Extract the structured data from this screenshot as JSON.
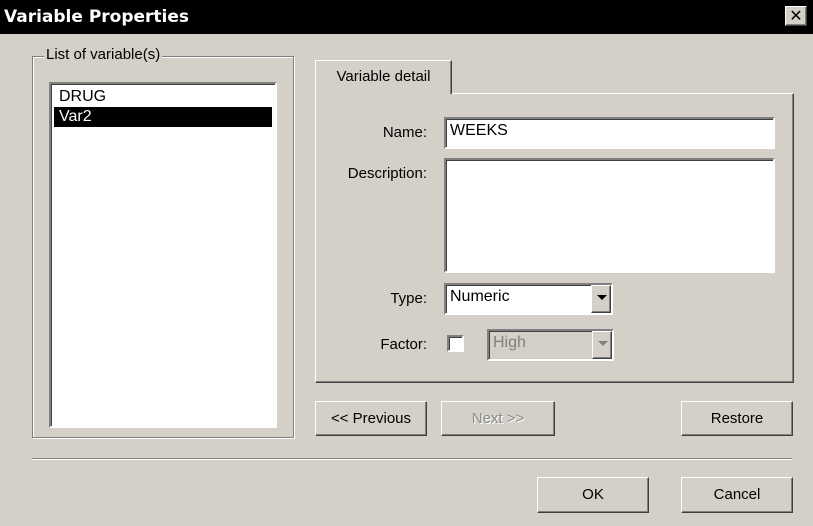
{
  "window": {
    "title": "Variable Properties",
    "close_label": "✕"
  },
  "variables_group": {
    "title": "List of variable(s)",
    "items": [
      {
        "label": "DRUG",
        "selected": false
      },
      {
        "label": "Var2",
        "selected": true
      }
    ]
  },
  "tabs": [
    {
      "label": "Variable detail"
    }
  ],
  "detail": {
    "name_label": "Name:",
    "name_value": "WEEKS",
    "description_label": "Description:",
    "description_value": "",
    "type_label": "Type:",
    "type_value": "Numeric",
    "factor_label": "Factor:",
    "factor_checked": false,
    "factor_level_value": "High"
  },
  "nav_buttons": {
    "previous": "<< Previous",
    "next": "Next >>",
    "restore": "Restore"
  },
  "footer_buttons": {
    "ok": "OK",
    "cancel": "Cancel"
  },
  "colors": {
    "titlebar": "#000000",
    "face": "#d4d0c8",
    "selection": "#000000"
  }
}
